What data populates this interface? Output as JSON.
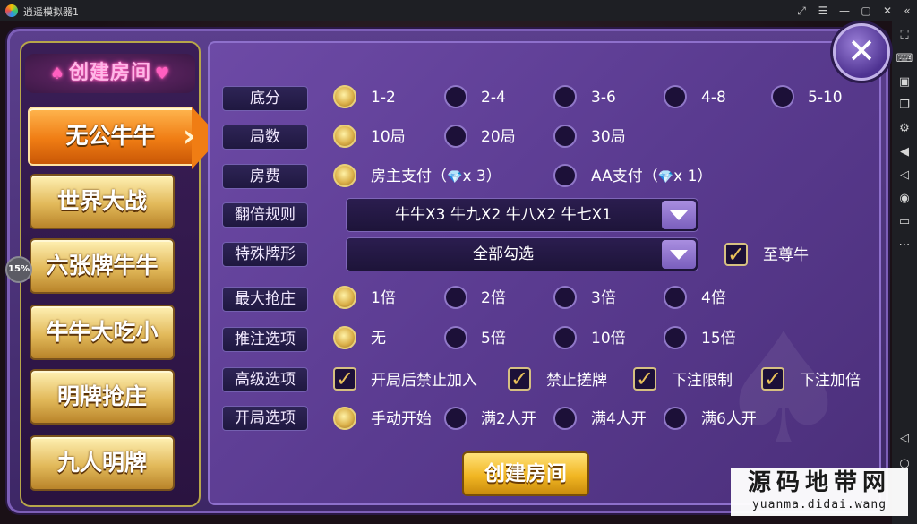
{
  "window": {
    "title": "逍遥模拟器1",
    "controls": [
      "expand-icon",
      "menu-icon",
      "minimize-icon",
      "maximize-icon",
      "close-icon",
      "collapse-icon"
    ]
  },
  "sidebar": {
    "icons": [
      "fullscreen-icon",
      "keyboard-icon",
      "screenshot-icon",
      "multi-window-icon",
      "settings-icon",
      "volume-up-icon",
      "volume-down-icon",
      "location-icon",
      "folder-icon",
      "more-icon",
      "back-icon",
      "home-icon"
    ]
  },
  "title_badge": {
    "text": "创建房间",
    "suit": "♠",
    "heart": "♥"
  },
  "games": [
    {
      "label": "无公牛牛",
      "active": true
    },
    {
      "label": "世界大战",
      "active": false
    },
    {
      "label": "六张牌牛牛",
      "active": false
    },
    {
      "label": "牛牛大吃小",
      "active": false
    },
    {
      "label": "明牌抢庄",
      "active": false
    },
    {
      "label": "九人明牌",
      "active": false
    }
  ],
  "progress_badge": "15%",
  "rows": {
    "base_score": {
      "label": "底分",
      "options": [
        {
          "text": "1-2",
          "selected": true
        },
        {
          "text": "2-4",
          "selected": false
        },
        {
          "text": "3-6",
          "selected": false
        },
        {
          "text": "4-8",
          "selected": false
        },
        {
          "text": "5-10",
          "selected": false
        }
      ]
    },
    "rounds": {
      "label": "局数",
      "options": [
        {
          "text": "10局",
          "selected": true
        },
        {
          "text": "20局",
          "selected": false
        },
        {
          "text": "30局",
          "selected": false
        }
      ]
    },
    "room_fee": {
      "label": "房费",
      "options": [
        {
          "text": "房主支付（",
          "suffix": "x 3）",
          "selected": true
        },
        {
          "text": "AA支付（",
          "suffix": "x 1）",
          "selected": false
        }
      ]
    },
    "double_rule": {
      "label": "翻倍规则",
      "value": "牛牛X3 牛九X2 牛八X2 牛七X1"
    },
    "special_cards": {
      "label": "特殊牌形",
      "value": "全部勾选",
      "extra_check": {
        "text": "至尊牛",
        "checked": true
      }
    },
    "max_banker": {
      "label": "最大抢庄",
      "options": [
        {
          "text": "1倍",
          "selected": true
        },
        {
          "text": "2倍",
          "selected": false
        },
        {
          "text": "3倍",
          "selected": false
        },
        {
          "text": "4倍",
          "selected": false
        }
      ]
    },
    "push_bet": {
      "label": "推注选项",
      "options": [
        {
          "text": "无",
          "selected": true
        },
        {
          "text": "5倍",
          "selected": false
        },
        {
          "text": "10倍",
          "selected": false
        },
        {
          "text": "15倍",
          "selected": false
        }
      ]
    },
    "advanced": {
      "label": "高级选项",
      "checks": [
        {
          "text": "开局后禁止加入",
          "checked": true
        },
        {
          "text": "禁止搓牌",
          "checked": true
        },
        {
          "text": "下注限制",
          "checked": true
        },
        {
          "text": "下注加倍",
          "checked": true
        }
      ]
    },
    "start": {
      "label": "开局选项",
      "options": [
        {
          "text": "手动开始",
          "selected": true
        },
        {
          "text": "满2人开",
          "selected": false
        },
        {
          "text": "满4人开",
          "selected": false
        },
        {
          "text": "满6人开",
          "selected": false
        }
      ]
    }
  },
  "create_button": "创建房间",
  "close_glyph": "✕",
  "watermark": {
    "big": "源码地带网",
    "small": "yuanma.didai.wang"
  },
  "colors": {
    "panel": "#5b3f8d",
    "active_game": "#f07d14",
    "gold": "#dcb24c"
  }
}
